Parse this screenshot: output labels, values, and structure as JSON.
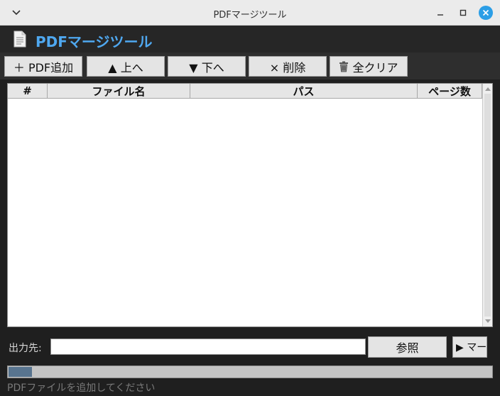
{
  "window": {
    "title": "PDFマージツール"
  },
  "app": {
    "title": "PDFマージツール"
  },
  "toolbar": {
    "add_label": "＋ PDF追加",
    "up_label": "▲ 上へ",
    "down_label": "▼ 下へ",
    "delete_label": "× 削除",
    "clear_icon": "trash-icon",
    "clear_label": "全クリア"
  },
  "table": {
    "columns": [
      "#",
      "ファイル名",
      "パス",
      "ページ数"
    ],
    "rows": []
  },
  "output": {
    "label": "出力先:",
    "value": "",
    "browse_label": "参照",
    "merge_label": "▶ マー"
  },
  "progress": {
    "fraction": 0.048
  },
  "status": {
    "text": "PDFファイルを追加してください"
  },
  "colors": {
    "accent": "#4fa8f0",
    "close": "#2b9ee6",
    "progress": "#58748f"
  }
}
